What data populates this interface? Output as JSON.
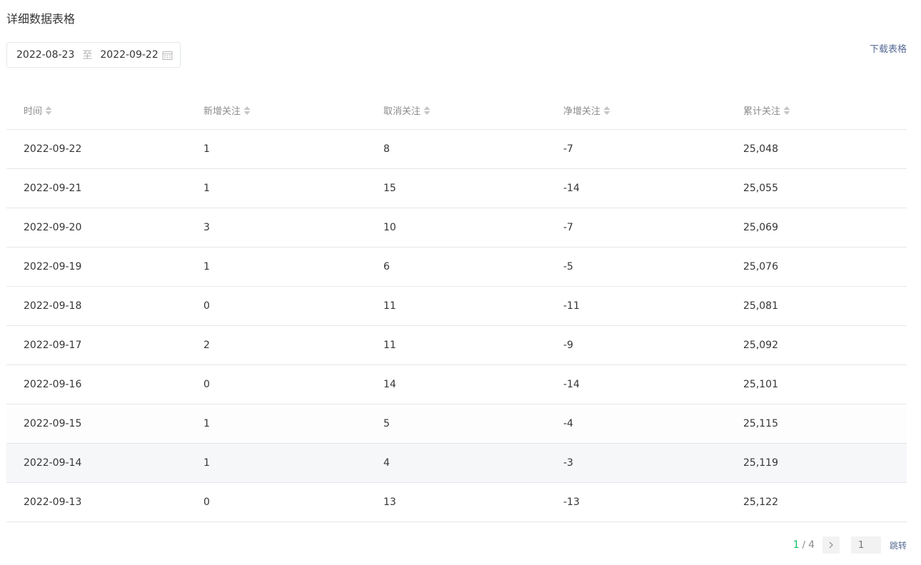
{
  "page": {
    "title": "详细数据表格",
    "download_label": "下载表格"
  },
  "date_range": {
    "start": "2022-08-23",
    "separator": "至",
    "end": "2022-09-22"
  },
  "table": {
    "headers": [
      "时间",
      "新增关注",
      "取消关注",
      "净增关注",
      "累计关注"
    ],
    "rows": [
      [
        "2022-09-22",
        "1",
        "8",
        "-7",
        "25,048"
      ],
      [
        "2022-09-21",
        "1",
        "15",
        "-14",
        "25,055"
      ],
      [
        "2022-09-20",
        "3",
        "10",
        "-7",
        "25,069"
      ],
      [
        "2022-09-19",
        "1",
        "6",
        "-5",
        "25,076"
      ],
      [
        "2022-09-18",
        "0",
        "11",
        "-11",
        "25,081"
      ],
      [
        "2022-09-17",
        "2",
        "11",
        "-9",
        "25,092"
      ],
      [
        "2022-09-16",
        "0",
        "14",
        "-14",
        "25,101"
      ],
      [
        "2022-09-15",
        "1",
        "5",
        "-4",
        "25,115"
      ],
      [
        "2022-09-14",
        "1",
        "4",
        "-3",
        "25,119"
      ],
      [
        "2022-09-13",
        "0",
        "13",
        "-13",
        "25,122"
      ]
    ]
  },
  "pagination": {
    "current": "1",
    "separator": "/",
    "total": "4",
    "jump_placeholder": "1",
    "jump_label": "跳转"
  },
  "colors": {
    "accent": "#07c160",
    "link": "#576b95"
  }
}
